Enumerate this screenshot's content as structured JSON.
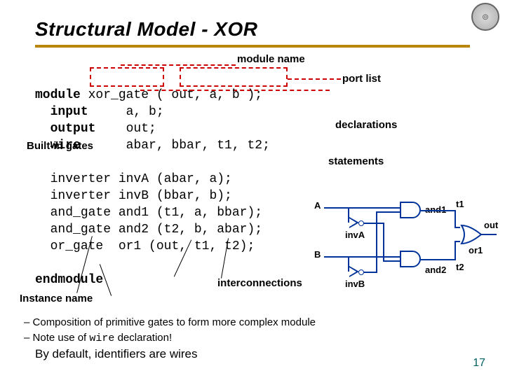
{
  "title": "Structural Model - XOR",
  "annotations": {
    "module_name": "module name",
    "port_list": "port list",
    "declarations": "declarations",
    "builtin_gates": "Built-in gates",
    "statements": "statements",
    "interconnections": "interconnections",
    "instance_name": "Instance name"
  },
  "code": {
    "l1_kw": "module",
    "l1_rest": " xor_gate ( out, a, b );",
    "l2_kw": "input",
    "l2_rest": "     a, b;",
    "l3_kw": "output",
    "l3_rest": "    out;",
    "l4_kw": "wire",
    "l4_rest": "      abar, bbar, t1, t2;",
    "l5": "inverter invA (abar, a);",
    "l6": "inverter invB (bbar, b);",
    "l7": "and_gate and1 (t1, a, bbar);",
    "l8": "and_gate and2 (t2, b, abar);",
    "l9": "or_gate  or1 (out, t1, t2);",
    "end_kw": "endmodule"
  },
  "diagram": {
    "inA": "A",
    "inB": "B",
    "invA": "invA",
    "invB": "invB",
    "and1": "and1",
    "and2": "and2",
    "or1": "or1",
    "t1": "t1",
    "t2": "t2",
    "out": "out"
  },
  "bullets": {
    "b1": "Composition of primitive gates to form more complex module",
    "b2_pre": "Note use of ",
    "b2_code": "wire",
    "b2_post": " declaration!",
    "last": "By default, identifiers are wires"
  },
  "pagenum": "17"
}
